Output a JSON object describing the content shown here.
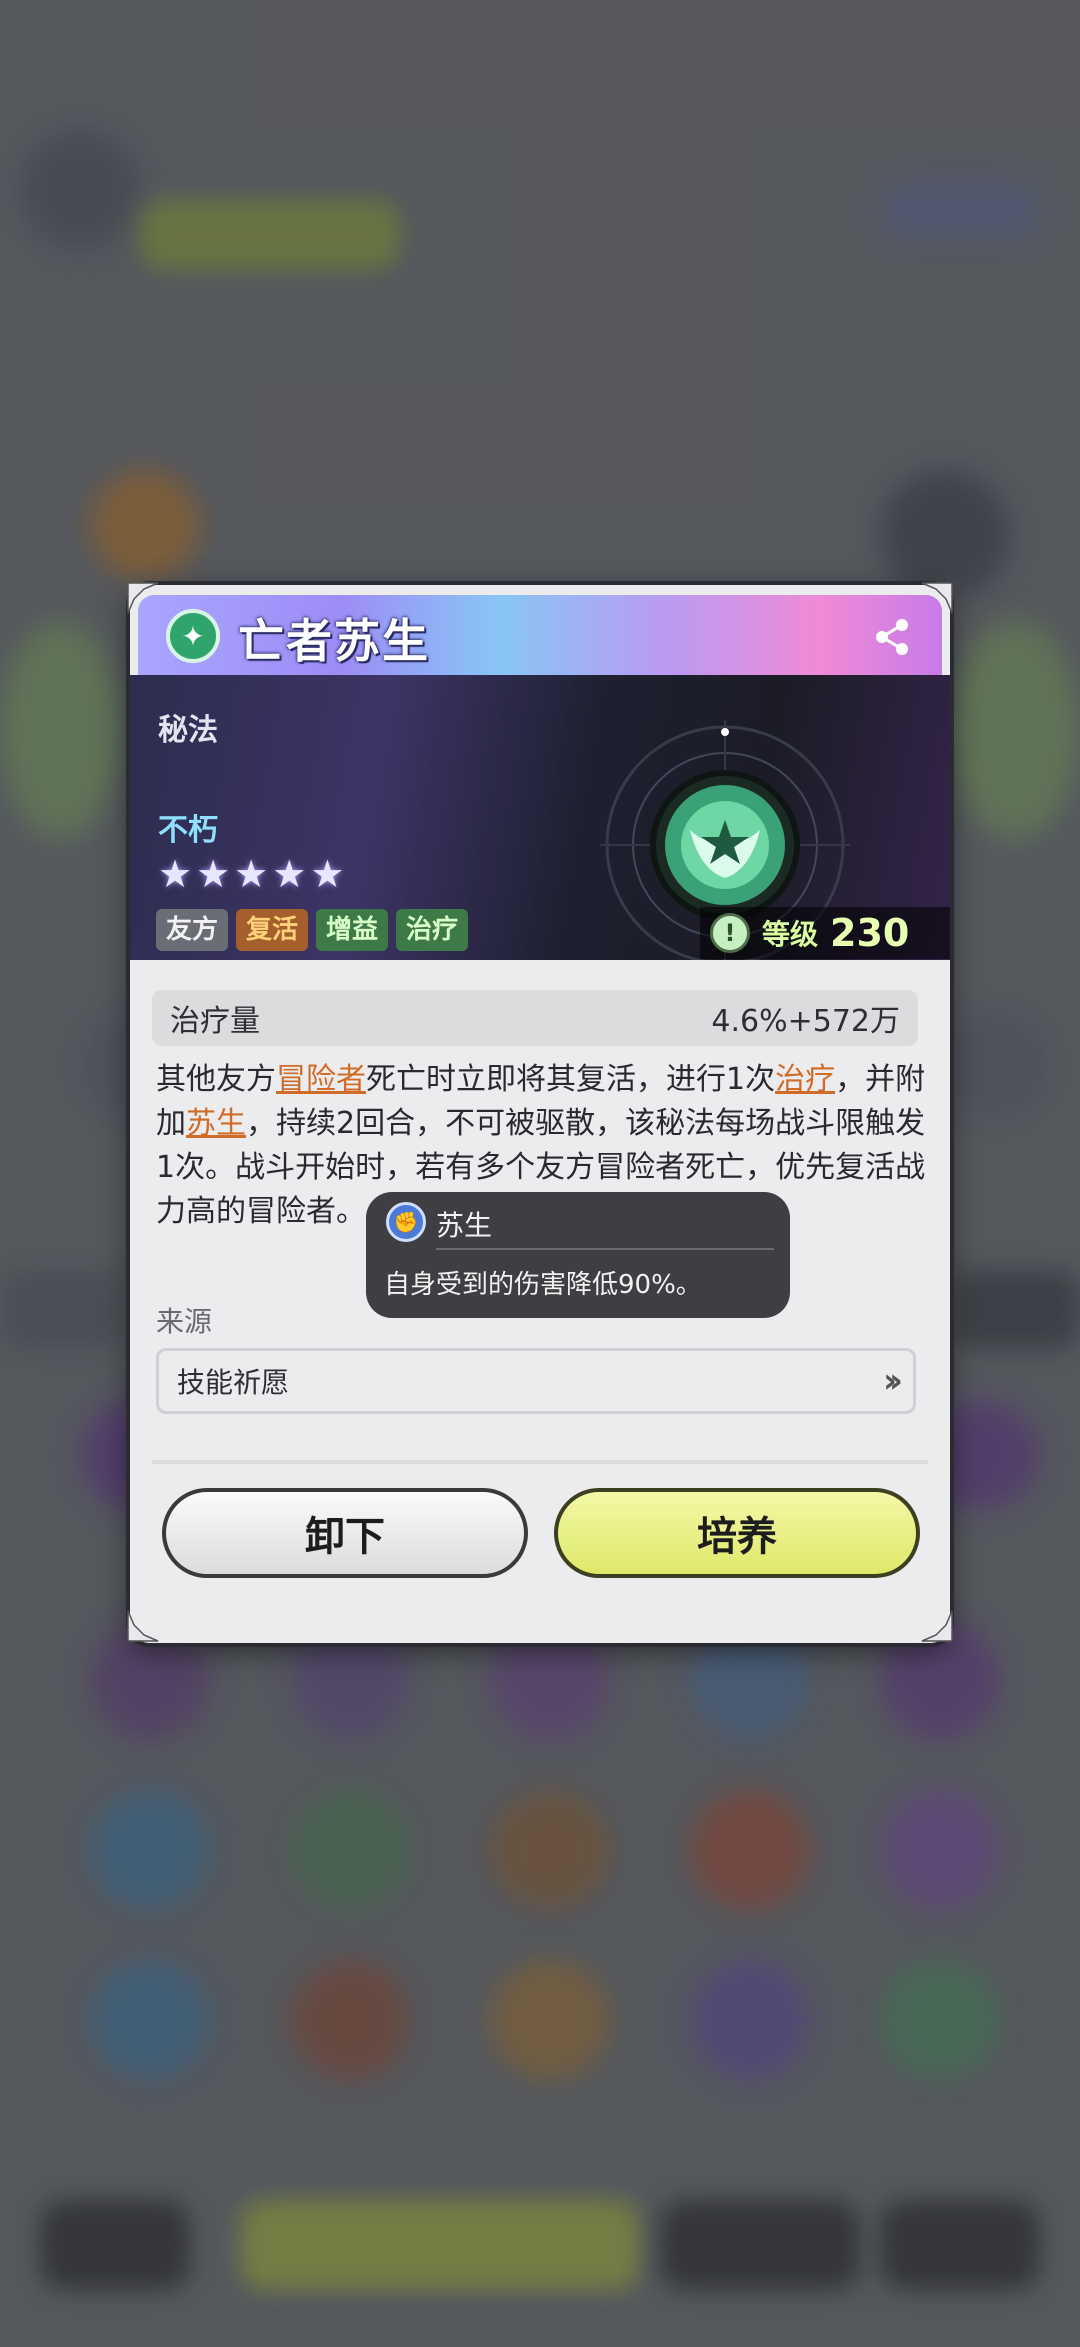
{
  "dialog": {
    "title": "亡者苏生",
    "type_label": "秘法",
    "rarity": "不朽",
    "stars": 5,
    "tags": [
      {
        "label": "友方",
        "color": "gray"
      },
      {
        "label": "复活",
        "color": "orange"
      },
      {
        "label": "增益",
        "color": "green"
      },
      {
        "label": "治疗",
        "color": "green"
      }
    ],
    "level_label": "等级",
    "level_value": "230",
    "stat_label": "治疗量",
    "stat_value": "4.6%+572万",
    "description": {
      "p1": "其他友方",
      "k1": "冒险者",
      "p2": "死亡时立即将其复活，进行1次",
      "k2": "治疗",
      "p3": "，并附加",
      "k3": "苏生",
      "p4": "，持续2回合，不可被驱散，该秘法每场战斗限触发1次。战斗开始时，若有多个友方冒险者死亡，优先复活战力高的冒险者。"
    },
    "source_label": "来源",
    "source_value": "技能祈愿",
    "unload_label": "卸下",
    "train_label": "培养"
  },
  "tooltip": {
    "name": "苏生",
    "desc": "自身受到的伤害降低90%。"
  },
  "colors": {
    "keyword": "#d06b28",
    "train_button": "#dfe86a",
    "level_text": "#e9ffb0"
  }
}
